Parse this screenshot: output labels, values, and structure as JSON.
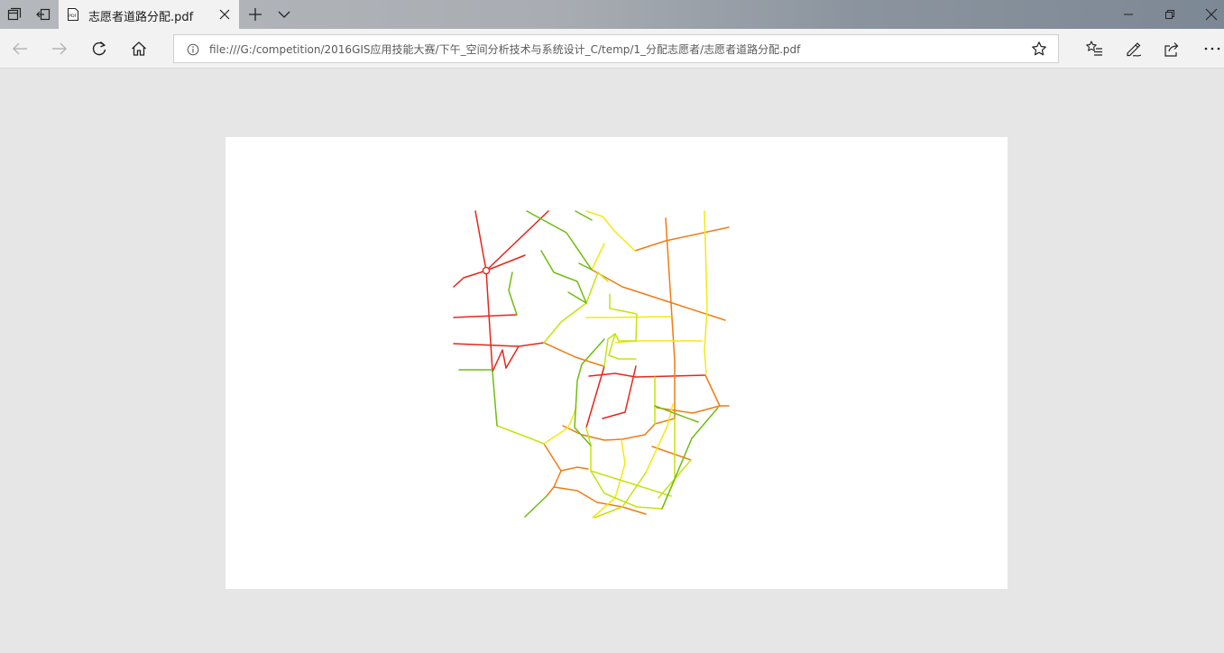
{
  "window": {
    "tab_title": "志愿者道路分配.pdf",
    "url": "file:///G:/competition/2016GIS应用技能大赛/下午_空间分析技术与系统设计_C/temp/1_分配志愿者/志愿者道路分配.pdf"
  },
  "icons": {
    "tab_actions": "tabs-aside-icon",
    "restore_tabs": "restore-tabs-icon",
    "pdf": "pdf-file-icon",
    "close_tab": "close-icon",
    "new_tab": "plus-icon",
    "tab_list": "chevron-down-icon",
    "back": "back-arrow-icon",
    "forward": "forward-arrow-icon",
    "refresh": "refresh-icon",
    "home": "home-icon",
    "site_info": "info-icon",
    "favorite": "star-icon",
    "favorites_hub": "favorites-list-icon",
    "notes": "pen-icon",
    "share": "share-icon",
    "more": "more-icon",
    "minimize": "minimize-icon",
    "maximize": "restore-icon",
    "close_window": "close-icon"
  },
  "colors": {
    "tab_strip": "#a9adb3",
    "chrome": "#f2f2f2",
    "viewer_bg": "#e6e6e6",
    "page_bg": "#ffffff",
    "road_red": "#e8251a",
    "road_orange": "#f27b12",
    "road_yellow": "#f5e90e",
    "road_yellowgreen": "#c6e30f",
    "road_green": "#6ebd10"
  }
}
